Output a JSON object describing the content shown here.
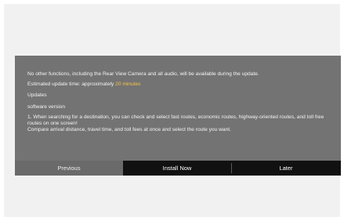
{
  "dialog": {
    "notice": "No other functions, including the Rear View Camera and all audio, will be available during the update.",
    "time_prefix": "Estimated update time: approximately ",
    "time_value": "20 minutes",
    "updates_label": "Updates",
    "software_label": "software version",
    "description_line1": "1. When searching for a destination, you can check and select fast routes, economic routes, highway-oriented routes, and toll free routes on one screen!",
    "description_line2": "Compare arrival distance, travel time, and toll fees at once and select the route you want.",
    "highlight_color": "#f5c542"
  },
  "buttons": {
    "previous": "Previous",
    "install_now": "Install Now",
    "later": "Later"
  }
}
